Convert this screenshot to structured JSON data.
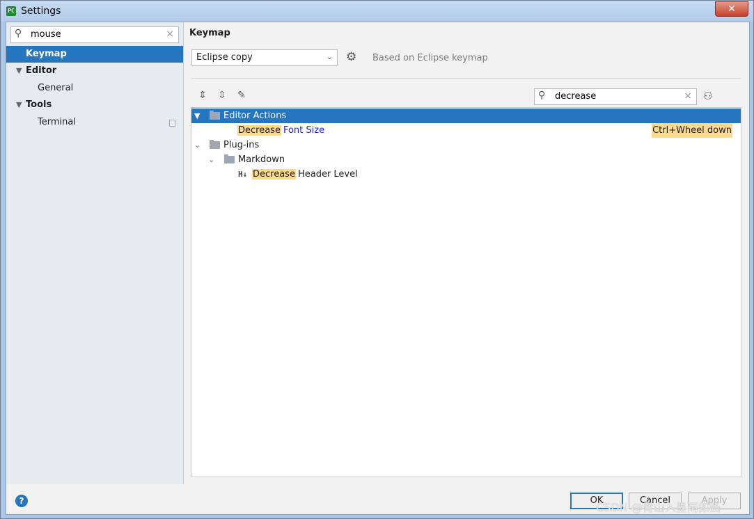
{
  "window": {
    "title": "Settings",
    "close_glyph": "✕",
    "app_icon_text": "PC"
  },
  "sidebar": {
    "search_value": "mouse",
    "items": [
      {
        "label": "Keymap",
        "selected": true
      },
      {
        "label": "Editor"
      },
      {
        "label": "General"
      },
      {
        "label": "Tools"
      },
      {
        "label": "Terminal"
      }
    ]
  },
  "content": {
    "title": "Keymap",
    "keymap_select": "Eclipse copy",
    "based_on": "Based on Eclipse keymap",
    "search_value": "decrease",
    "tree": {
      "editor_actions": "Editor Actions",
      "decrease_font_hl": "Decrease",
      "decrease_font_rest": "Font Size",
      "decrease_font_shortcut": "Ctrl+Wheel down",
      "plugins": "Plug-ins",
      "markdown": "Markdown",
      "decrease_header_hl": "Decrease",
      "decrease_header_rest": "Header Level",
      "header_icon_text": "H↓"
    }
  },
  "footer": {
    "help": "?",
    "ok": "OK",
    "cancel": "Cancel",
    "apply": "Apply",
    "watermark": "CSDN @青山入墨雨如画"
  },
  "colors": {
    "selection": "#2675bf",
    "highlight": "#fdd98c",
    "link": "#1f1fcf"
  }
}
